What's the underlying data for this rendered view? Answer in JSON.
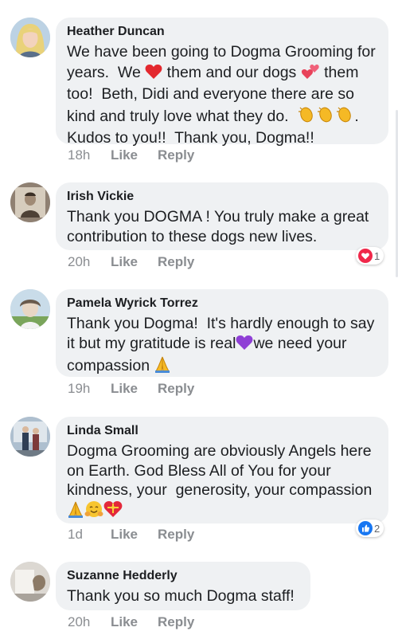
{
  "comments": [
    {
      "name": "Heather Duncan",
      "text_parts": [
        "We have been going to Dogma Grooming for years.  We ",
        " them and our dogs ",
        " them too!  Beth, Didi and everyone there are so kind and truly love what they do.  ",
        ".\nKudos to you!!  Thank you, Dogma!!"
      ],
      "time": "18h",
      "like": "Like",
      "reply": "Reply",
      "emojis": [
        "red-heart",
        "two-hearts",
        "clapping-hands"
      ]
    },
    {
      "name": "Irish Vickie",
      "text": "Thank you DOGMA ! You truly make a great contribution to these dogs new lives.",
      "time": "20h",
      "like": "Like",
      "reply": "Reply",
      "reaction": {
        "icon": "love-reaction",
        "count": "1"
      }
    },
    {
      "name": "Pamela Wyrick Torrez",
      "text_parts": [
        "Thank you Dogma!  It's hardly enough to say it but my gratitude is real",
        "we need your compassion "
      ],
      "time": "19h",
      "like": "Like",
      "reply": "Reply",
      "emojis": [
        "purple-heart",
        "folded-hands"
      ]
    },
    {
      "name": "Linda Small",
      "text": "Dogma Grooming are obviously Angels here on Earth. God Bless All of You for your kindness, your  generosity, your compassion",
      "time": "1d",
      "like": "Like",
      "reply": "Reply",
      "emojis": [
        "folded-hands",
        "hugging-face",
        "heart-with-ribbon"
      ],
      "reaction": {
        "icon": "like-reaction",
        "count": "2"
      }
    },
    {
      "name": "Suzanne Hedderly",
      "text": "Thank you so much Dogma staff!",
      "time": "20h",
      "like": "Like",
      "reply": "Reply"
    }
  ]
}
